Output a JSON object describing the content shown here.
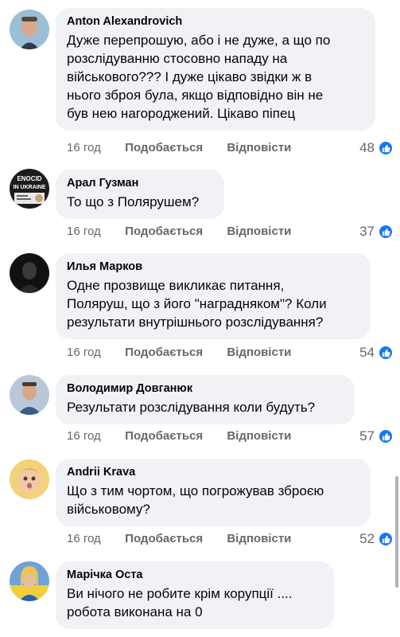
{
  "labels": {
    "like": "Подобається",
    "reply": "Відповісти"
  },
  "colors": {
    "bubble": "#f0f2f5",
    "meta": "#65676b",
    "like_badge": "#1877f2"
  },
  "comments": [
    {
      "author": "Anton Alexandrovich",
      "text": "Дуже перепрошую, або і не дуже,  а що по\nрозслідуванню стосовно нападу на\nвійськового??? І дуже цікаво звідки ж в\nнього зброя була, якщо відповідно він не\nбув нею нагороджений.  Цікаво піпец",
      "time": "16 год",
      "reactions": "48",
      "avatar_icon": "man-avatar-icon"
    },
    {
      "author": "Арал Гузман",
      "text": "То що з Полярушем?",
      "time": "16 год",
      "reactions": "37",
      "avatar_icon": "poster-avatar-icon",
      "avatar_text": "ENOCID\nIN UKRAINE"
    },
    {
      "author": "Илья Марков",
      "text": "Одне прозвище викликає питання,\nПоляруш, що з його \"нагрaдняком\"? Коли\nрезультати внутрішнього розслідування?",
      "time": "16 год",
      "reactions": "54",
      "avatar_icon": "dark-portrait-avatar-icon"
    },
    {
      "author": "Володимир Довганюк",
      "text": "Результати розслідування коли будуть?",
      "time": "16 год",
      "reactions": "57",
      "avatar_icon": "man-avatar-icon"
    },
    {
      "author": "Andrii Krava",
      "text": "Що з тим чортом, що погрожував зброєю\nвійськовому?",
      "time": "16 год",
      "reactions": "52",
      "avatar_icon": "child-avatar-icon"
    },
    {
      "author": "Марічка Оста",
      "text": "Ви нічого не робите крім корупції ....\nробота виконана на 0",
      "time": "",
      "reactions": "",
      "avatar_icon": "woman-avatar-icon"
    }
  ]
}
